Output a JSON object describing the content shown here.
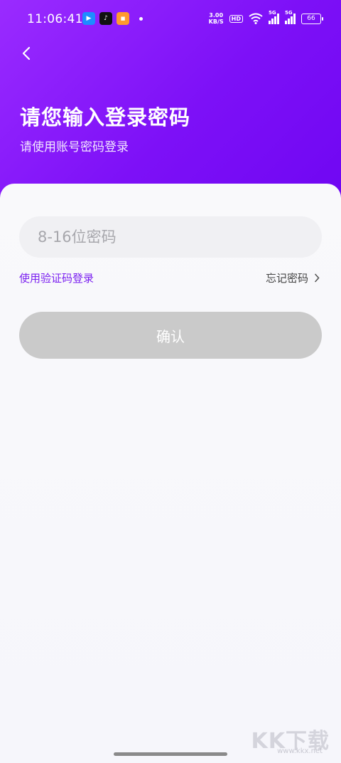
{
  "status_bar": {
    "time": "11:06:41",
    "net_speed_value": "3.00",
    "net_speed_unit": "KB/S",
    "hd_label": "HD",
    "signal_1": "5G",
    "signal_2": "5G",
    "battery": "66"
  },
  "header": {
    "title": "请您输入登录密码",
    "subtitle": "请使用账号密码登录"
  },
  "form": {
    "password_placeholder": "8-16位密码",
    "password_value": "",
    "sms_login_link": "使用验证码登录",
    "forgot_password_link": "忘记密码",
    "confirm_button": "确认"
  },
  "watermark": {
    "text": "KK下载",
    "url": "www.kkx.net"
  },
  "colors": {
    "header_gradient_start": "#9a2bff",
    "header_gradient_end": "#6f06f2",
    "link_purple": "#7a1ff0",
    "button_disabled": "#cacaca"
  }
}
